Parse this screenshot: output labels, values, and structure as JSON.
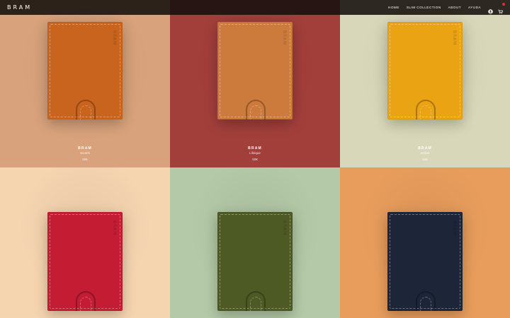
{
  "header": {
    "logo": "BRAM",
    "nav": [
      "HOME",
      "SLIM COLLECTION",
      "ABOUT",
      "AYUDA"
    ]
  },
  "products": [
    {
      "bg": "#d8a27c",
      "wallet_color": "#c9641e",
      "caption_visible": true,
      "brand": "BRAM",
      "name": "Scotch",
      "price": "50€"
    },
    {
      "bg": "#a33f3b",
      "wallet_color": "#cc7b3c",
      "caption_visible": true,
      "brand": "BRAM",
      "name": "Lifeique",
      "price": "50€"
    },
    {
      "bg": "#d9d7b9",
      "wallet_color": "#e9a313",
      "caption_visible": true,
      "brand": "BRAM",
      "name": "Amber",
      "price": "50€"
    },
    {
      "bg": "#f5d4b0",
      "wallet_color": "#c41d33",
      "caption_visible": false
    },
    {
      "bg": "#b3c9a7",
      "wallet_color": "#4e5a24",
      "caption_visible": false
    },
    {
      "bg": "#e89d5c",
      "wallet_color": "#1d2638",
      "caption_visible": false
    }
  ],
  "emboss_text": "BRAM",
  "icons": {
    "account": "user-circle-icon",
    "cart": "cart-icon",
    "cart_badge_color": "#e0302c"
  }
}
